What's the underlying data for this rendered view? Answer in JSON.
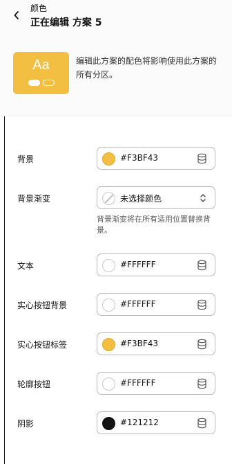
{
  "header": {
    "breadcrumb": "颜色",
    "title": "正在编辑 方案 5"
  },
  "preview": {
    "sample_text": "Aa",
    "background_color": "#F3BF43",
    "description": "编辑此方案的配色将影响使用此方案的所有分区。"
  },
  "fields": [
    {
      "label": "背景",
      "value": "#F3BF43",
      "swatch": "#F3BF43",
      "icon": "database-icon"
    },
    {
      "label": "背景渐变",
      "value": "未选择颜色",
      "swatch": "none",
      "icon": "chevron-up-down-icon",
      "help": "背景渐变将在所有适用位置替换背景。"
    },
    {
      "label": "文本",
      "value": "#FFFFFF",
      "swatch": "#FFFFFF",
      "icon": "database-icon"
    },
    {
      "label": "实心按钮背景",
      "value": "#FFFFFF",
      "swatch": "#FFFFFF",
      "icon": "database-icon"
    },
    {
      "label": "实心按钮标签",
      "value": "#F3BF43",
      "swatch": "#F3BF43",
      "icon": "database-icon"
    },
    {
      "label": "轮廓按钮",
      "value": "#FFFFFF",
      "swatch": "#FFFFFF",
      "icon": "database-icon"
    },
    {
      "label": "阴影",
      "value": "#121212",
      "swatch": "#121212",
      "icon": "database-icon"
    }
  ]
}
